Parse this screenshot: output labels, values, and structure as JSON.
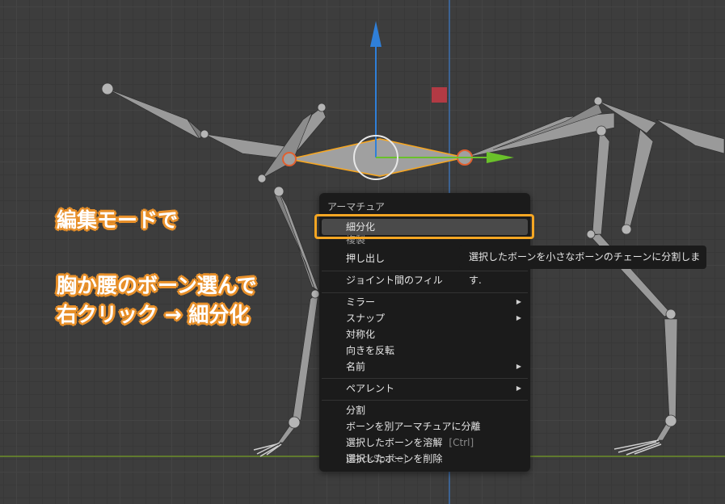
{
  "annotations": {
    "line1": "編集モードで",
    "line2": "胸か腰のボーン選んで",
    "line3": "右クリック → 細分化"
  },
  "context_menu": {
    "title": "アーマチュア",
    "items": [
      {
        "label": "細分化",
        "highlighted": true
      },
      {
        "label": "複製"
      },
      {
        "label": "押し出し"
      },
      {
        "label": "ジョイント間のフィル"
      },
      {
        "label": "ミラー",
        "submenu": true
      },
      {
        "label": "スナップ",
        "submenu": true
      },
      {
        "label": "対称化"
      },
      {
        "label": "向きを反転"
      },
      {
        "label": "名前",
        "submenu": true
      },
      {
        "label": "ペアレント",
        "submenu": true
      },
      {
        "label": "分割"
      },
      {
        "label": "ボーンを別アーマチュアに分離"
      },
      {
        "label": "選択したボーンを溶解",
        "shortcut": "[Ctrl] [BackSpace]"
      },
      {
        "label": "選択したボーンを削除"
      }
    ],
    "submenu_arrow": "▶"
  },
  "tooltip": {
    "text": "選択したボーンを小さなボーンのチェーンに分割します."
  },
  "colors": {
    "highlight_box": "#f5a623",
    "annotation_outline": "#e8902a",
    "gizmo_z": "#2f7fd8",
    "gizmo_y": "#6ac12a",
    "selected_bone": "#f5a623"
  }
}
